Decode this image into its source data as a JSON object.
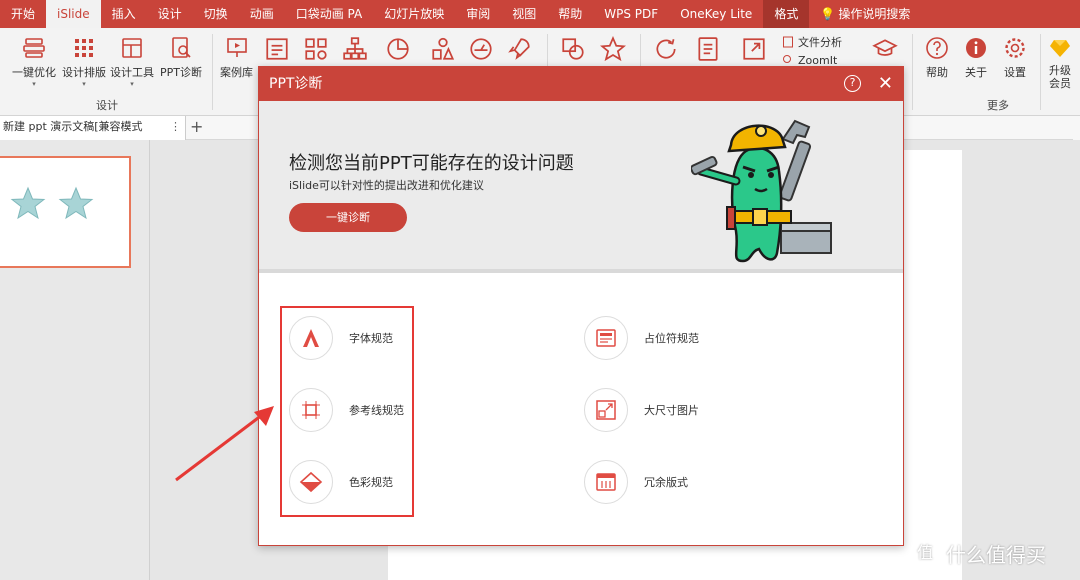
{
  "tabs": [
    "开始",
    "iSlide",
    "插入",
    "设计",
    "切换",
    "动画",
    "口袋动画 PA",
    "幻灯片放映",
    "审阅",
    "视图",
    "帮助",
    "WPS PDF",
    "OneKey Lite",
    "格式",
    "操作说明搜索"
  ],
  "ribbon": {
    "yijian": "一键优化",
    "sheji_paiban": "设计排版",
    "sheji_gongju": "设计工具",
    "ppt_zhenduan": "PPT诊断",
    "anliku": "案例库",
    "group_sheji": "设计",
    "file_analysis": "文件分析",
    "zoomit": "ZoomIt",
    "help": "帮助",
    "about": "关于",
    "settings": "设置",
    "upgrade_line1": "升级",
    "upgrade_line2": "会员",
    "group_more": "更多"
  },
  "doc": {
    "tab_title": "新建 ppt 演示文稿[兼容模式"
  },
  "dialog": {
    "title": "PPT诊断",
    "headline": "检测您当前PPT可能存在的设计问题",
    "subline": "iSlide可以针对性的提出改进和优化建议",
    "button": "一键诊断",
    "items_left": [
      "字体规范",
      "参考线规范",
      "色彩规范"
    ],
    "items_right": [
      "占位符规范",
      "大尺寸图片",
      "冗余版式"
    ]
  },
  "watermark": {
    "text": "什么值得买",
    "glyph": "值"
  },
  "colors": {
    "accent": "#c9443a",
    "highlight": "#e53935",
    "star": "#a8d4d6"
  }
}
